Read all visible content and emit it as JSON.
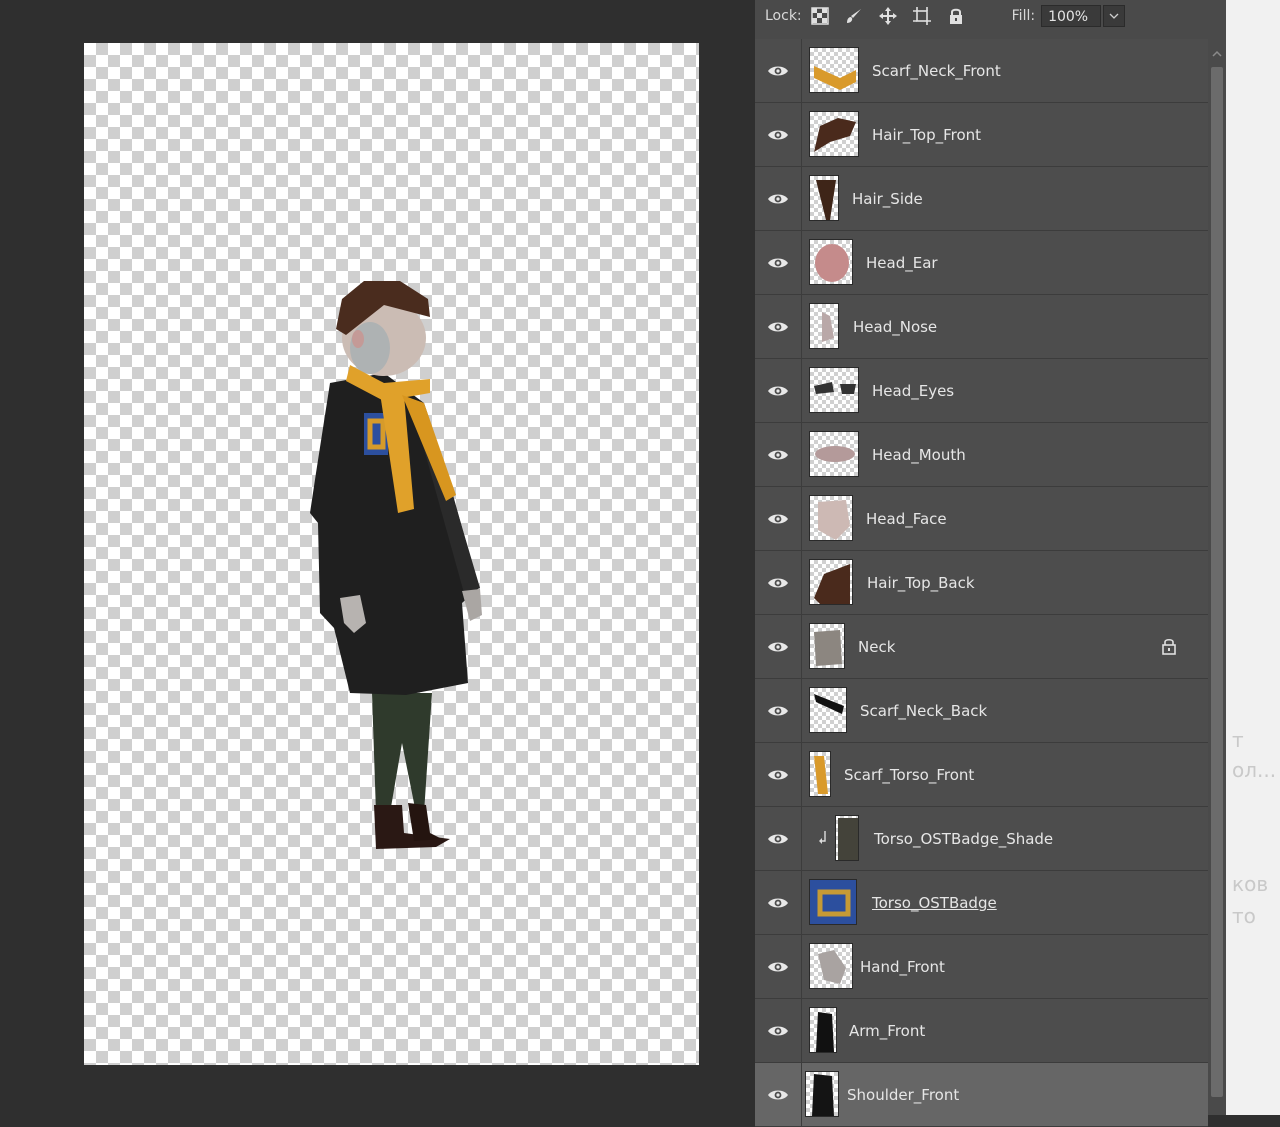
{
  "lockbar": {
    "lock_label": "Lock:",
    "fill_label": "Fill:",
    "fill_value": "100%",
    "icons": [
      "lock-transparent-pixels-icon",
      "lock-image-pixels-icon",
      "lock-position-icon",
      "lock-artboard-icon",
      "lock-all-icon"
    ]
  },
  "layers": [
    {
      "name": "Scarf_Neck_Front",
      "thumb": "scarf-neck-front-thumbnail"
    },
    {
      "name": "Hair_Top_Front",
      "thumb": "hair-top-front-thumbnail"
    },
    {
      "name": "Hair_Side",
      "thumb": "hair-side-thumbnail"
    },
    {
      "name": "Head_Ear",
      "thumb": "head-ear-thumbnail"
    },
    {
      "name": "Head_Nose",
      "thumb": "head-nose-thumbnail"
    },
    {
      "name": "Head_Eyes",
      "thumb": "head-eyes-thumbnail"
    },
    {
      "name": "Head_Mouth",
      "thumb": "head-mouth-thumbnail"
    },
    {
      "name": "Head_Face",
      "thumb": "head-face-thumbnail"
    },
    {
      "name": "Hair_Top_Back",
      "thumb": "hair-top-back-thumbnail"
    },
    {
      "name": "Neck",
      "thumb": "neck-thumbnail",
      "locked": true
    },
    {
      "name": "Scarf_Neck_Back",
      "thumb": "scarf-neck-back-thumbnail"
    },
    {
      "name": "Scarf_Torso_Front",
      "thumb": "scarf-torso-front-thumbnail"
    },
    {
      "name": "Torso_OSTBadge_Shade",
      "thumb": "torso-ostbadge-shade-thumbnail",
      "clipped": true
    },
    {
      "name": "Torso_OSTBadge",
      "thumb": "torso-ostbadge-thumbnail"
    },
    {
      "name": "Hand_Front",
      "thumb": "hand-front-thumbnail"
    },
    {
      "name": "Arm_Front",
      "thumb": "arm-front-thumbnail"
    },
    {
      "name": "Shoulder_Front",
      "thumb": "shoulder-front-thumbnail",
      "selected": true
    }
  ],
  "colors": {
    "panel": "#4a4a4a",
    "selected_row": "#666666",
    "scarf": "#e0a12a",
    "coat": "#1c1c1c",
    "hair": "#4a2c1e",
    "badge_blue": "#2c4f9e"
  },
  "background_ghost_text": [
    "т",
    "ол...",
    "ков",
    "то"
  ]
}
